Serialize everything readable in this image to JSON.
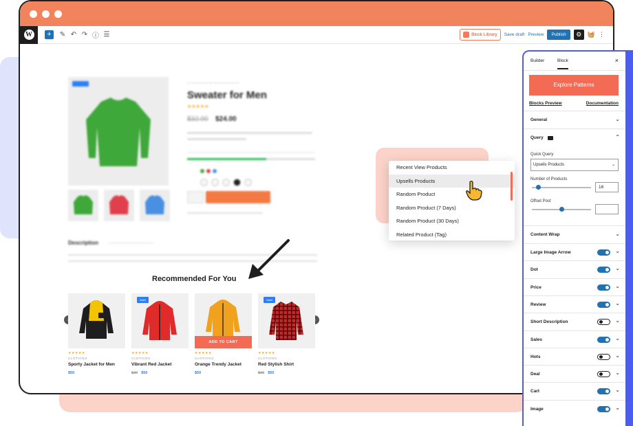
{
  "colors": {
    "accent": "#f36b55",
    "brand_blue": "#2271b1",
    "panel_border": "#4b5cf0",
    "titlebar": "#f2845d"
  },
  "toolbar": {
    "block_library": "Block Library",
    "save_draft": "Save draft",
    "preview": "Preview",
    "publish": "Publish"
  },
  "product": {
    "title": "Sweater for Men",
    "old_price": "$32.00",
    "new_price": "$24.00",
    "description_heading": "Description"
  },
  "recommended": {
    "title": "Recommended For You",
    "cards": [
      {
        "name": "Sporty Jacket for Men",
        "category": "CLOTHING",
        "stars": "★★★★★",
        "old_price": "",
        "price": "$50",
        "sale": ""
      },
      {
        "name": "Vibrant Red Jacket",
        "category": "CLOTHING",
        "stars": "★★★★★",
        "old_price": "$30",
        "price": "$50",
        "sale": "Sale!"
      },
      {
        "name": "Orange Trendy Jacket",
        "category": "CLOTHING",
        "stars": "★★★★★",
        "old_price": "",
        "price": "$50",
        "sale": "",
        "overlay": "ADD TO CART"
      },
      {
        "name": "Red Stylish Shirt",
        "category": "CLOTHING",
        "stars": "★★★★★",
        "old_price": "$30",
        "price": "$50",
        "sale": "Sale!"
      }
    ]
  },
  "dropdown": {
    "items": [
      "Recent View Products",
      "Upsells Products",
      "Random Product",
      "Random Product (7 Days)",
      "Random Product (30 Days)",
      "Related Product (Tag)"
    ],
    "selected_index": 1
  },
  "panel": {
    "tabs": [
      "Builder",
      "Block"
    ],
    "active_tab": "Block",
    "close": "×",
    "explore": "Explore Patterns",
    "links": [
      "Blocks Preview",
      "Documentation"
    ],
    "general": "General",
    "query": "Query",
    "quick_query_label": "Quick Query",
    "quick_query_value": "Upsells Products",
    "num_products_label": "Number of Products",
    "num_products_value": "16",
    "offset_label": "Offset Post",
    "offset_value": "",
    "content_wrap": "Content Wrap",
    "toggles": [
      {
        "label": "Large Image Arrow",
        "on": true
      },
      {
        "label": "Dot",
        "on": true
      },
      {
        "label": "Price",
        "on": true
      },
      {
        "label": "Review",
        "on": true
      },
      {
        "label": "Short Description",
        "on": false
      },
      {
        "label": "Sales",
        "on": true
      },
      {
        "label": "Hots",
        "on": false
      },
      {
        "label": "Deal",
        "on": false
      },
      {
        "label": "Cart",
        "on": true
      },
      {
        "label": "Image",
        "on": true
      }
    ]
  }
}
